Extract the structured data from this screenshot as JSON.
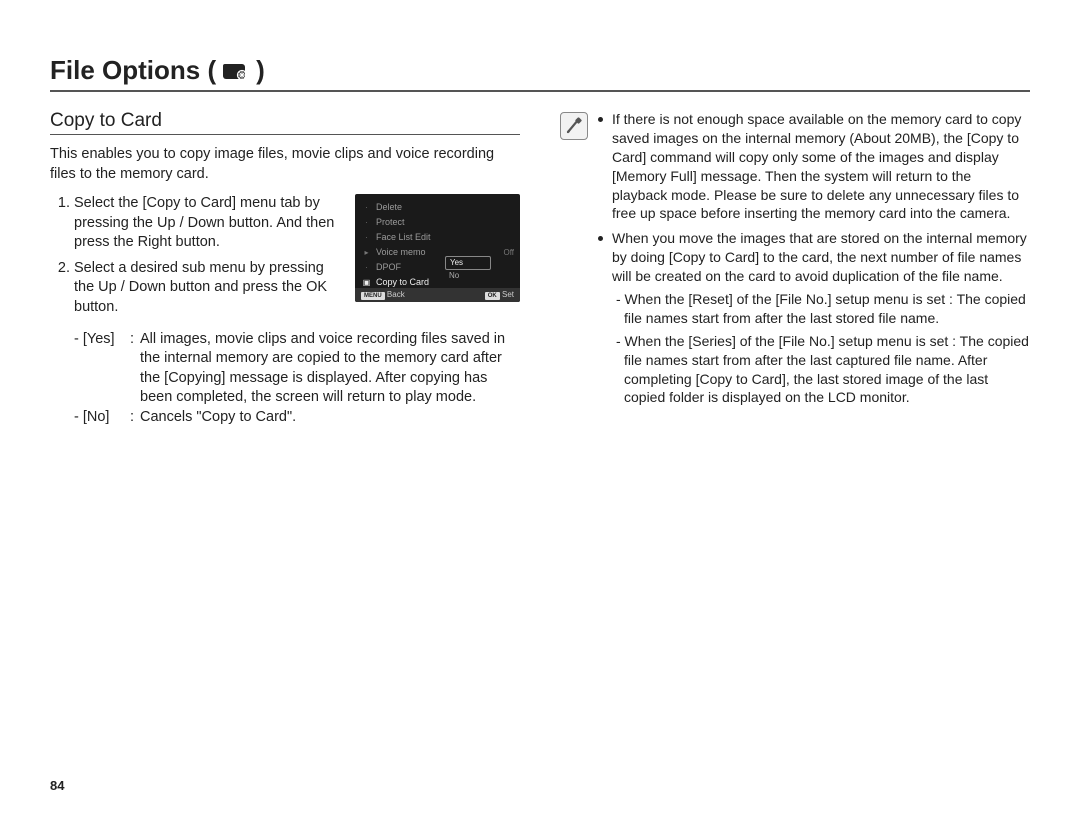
{
  "page_number": "84",
  "title_prefix": "File Options (",
  "title_suffix": " )",
  "section_title": "Copy to Card",
  "intro": "This enables you to copy image files, movie clips and voice recording files to the memory card.",
  "steps": {
    "s1": "Select the [Copy to Card] menu tab by pressing the Up / Down button. And then press the Right button.",
    "s2": "Select a desired sub menu by pressing the Up / Down button and press the OK button."
  },
  "options": {
    "yes_label": "- [Yes]",
    "yes_desc": "All images, movie clips and voice recording files saved in the internal memory are copied to the memory card after the [Copying] message is displayed. After copying has been completed, the screen will return to play mode.",
    "no_label": "- [No]",
    "no_desc": "Cancels \"Copy to Card\"."
  },
  "notes": {
    "n1": "If there is not enough space available on the memory card to copy saved images on the internal memory (About 20MB), the [Copy to Card] command will copy only some of the images and display [Memory Full] message. Then the system will return to the playback mode. Please be sure to delete any unnecessary files to free up space before inserting the memory card into the camera.",
    "n2": "When you move the images that are stored on the internal memory by doing [Copy to Card] to the card, the next number of file names will be created on the card to avoid duplication of the file name.",
    "n2a": "- When the [Reset] of the [File No.] setup menu is set : The copied file names start from after the last stored file name.",
    "n2b": "- When the [Series] of the [File No.] setup menu is set : The copied file names start from after the last captured file name. After completing [Copy to Card], the last stored image of the last copied folder is displayed on the LCD monitor."
  },
  "lcd": {
    "items": [
      "Delete",
      "Protect",
      "Face List Edit",
      "Voice memo",
      "DPOF",
      "Copy to Card"
    ],
    "voice_memo_value": "Off",
    "yes": "Yes",
    "no": "No",
    "back_badge": "MENU",
    "back": "Back",
    "set_badge": "OK",
    "set": "Set"
  }
}
